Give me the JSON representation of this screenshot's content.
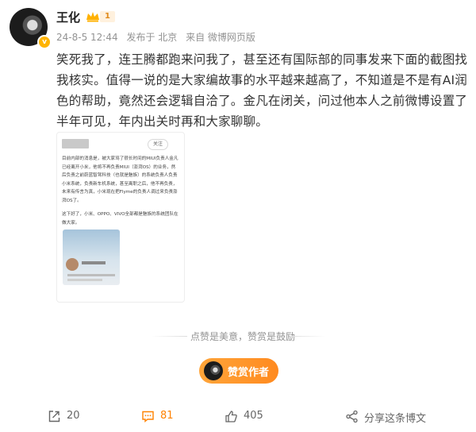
{
  "author": {
    "name": "王化",
    "vip_level": "1",
    "avatar_badge": "v"
  },
  "meta": {
    "date": "24-8-5 12:44",
    "location": "发布于 北京",
    "source": "来自 微博网页版"
  },
  "post": {
    "text": "笑死我了，连王腾都跑来问我了，甚至还有国际部的同事发来下面的截图找我核实。值得一说的是大家编故事的水平越来越高了，不知道是不是有AI润色的帮助，竟然还会逻辑自洽了。金凡在闭关，问过他本人之前微博设置了半年可见，年内出关时再和大家聊聊。"
  },
  "embedded_image": {
    "follow_label": "关注",
    "paragraph1": "目前内部的消息是，被大家骂了很长时间的MIUI负责人金凡已经离开小米，他将不再负责MIUI（澎湃OS）的业务，然后负责之前蔚蓝智驾科技（也就是魅族）的系统负责人负责小米系统，负责新车机系统，甚至离职之后，他不再负责，未来有传言为真，小米现在把Flyme的负责人调过来负责澎湃OS了。",
    "paragraph2": "这下好了，小米、OPPO、VIVO全部都是魅族的系统团队在做大家。"
  },
  "reward": {
    "hint": "点赞是美意，赞赏是鼓励",
    "button_label": "赞赏作者"
  },
  "actions": {
    "forward_count": "20",
    "comment_count": "81",
    "like_count": "405",
    "share_label": "分享这条博文"
  },
  "colors": {
    "accent": "#ff8200",
    "reward_gradient_start": "#ffa53a",
    "reward_gradient_end": "#ff8a1f",
    "vip_bg": "#fff1de",
    "vip_text": "#e08a1a",
    "muted_text": "#939393"
  },
  "icons": {
    "forward": "forward-icon",
    "comment": "comment-icon",
    "like": "thumbs-up-icon",
    "share": "share-icon",
    "crown": "crown-icon"
  }
}
